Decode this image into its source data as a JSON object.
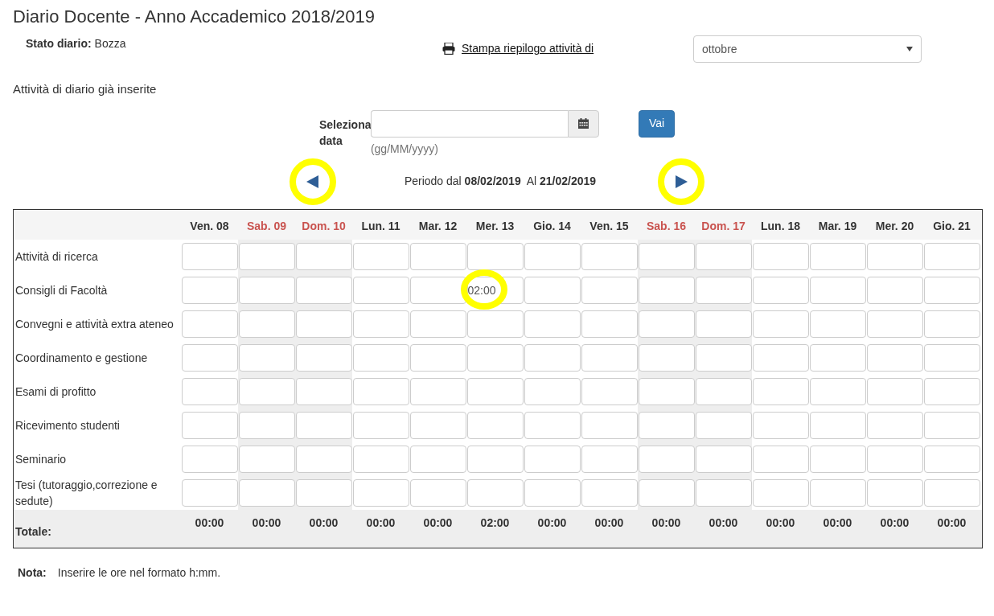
{
  "title": "Diario Docente - Anno Accademico 2018/2019",
  "status": {
    "label": "Stato diario:",
    "value": "Bozza"
  },
  "print_link": "Stampa riepilogo attività di",
  "month_select": {
    "value": "ottobre"
  },
  "section_title": "Attività di diario già inserite",
  "date_picker": {
    "label": "Seleziona data",
    "hint": "(gg/MM/yyyy)",
    "button": "Vai"
  },
  "period": {
    "prefix": "Periodo dal",
    "from": "08/02/2019",
    "middle": "Al",
    "to": "21/02/2019"
  },
  "prev_button": {
    "highlighted": true
  },
  "next_button": {
    "highlighted": true
  },
  "days": [
    {
      "label": "Ven. 08",
      "weekend": false
    },
    {
      "label": "Sab. 09",
      "weekend": true
    },
    {
      "label": "Dom. 10",
      "weekend": true
    },
    {
      "label": "Lun. 11",
      "weekend": false
    },
    {
      "label": "Mar. 12",
      "weekend": false
    },
    {
      "label": "Mer. 13",
      "weekend": false
    },
    {
      "label": "Gio. 14",
      "weekend": false
    },
    {
      "label": "Ven. 15",
      "weekend": false
    },
    {
      "label": "Sab. 16",
      "weekend": true
    },
    {
      "label": "Dom. 17",
      "weekend": true
    },
    {
      "label": "Lun. 18",
      "weekend": false
    },
    {
      "label": "Mar. 19",
      "weekend": false
    },
    {
      "label": "Mer. 20",
      "weekend": false
    },
    {
      "label": "Gio. 21",
      "weekend": false
    }
  ],
  "rows": [
    {
      "label": "Attività di ricerca",
      "cells": [
        {},
        {},
        {},
        {},
        {},
        {},
        {},
        {},
        {},
        {},
        {},
        {},
        {},
        {}
      ]
    },
    {
      "label": "Consigli di Facoltà",
      "cells": [
        {},
        {},
        {},
        {},
        {},
        {
          "value": "02:00",
          "highlighted": true
        },
        {},
        {},
        {},
        {},
        {},
        {},
        {},
        {}
      ]
    },
    {
      "label": "Convegni e attività extra ateneo",
      "cells": [
        {},
        {},
        {},
        {},
        {},
        {},
        {},
        {},
        {},
        {},
        {},
        {},
        {},
        {}
      ]
    },
    {
      "label": "Coordinamento e gestione",
      "cells": [
        {},
        {},
        {},
        {},
        {},
        {},
        {},
        {},
        {},
        {},
        {},
        {},
        {},
        {}
      ]
    },
    {
      "label": "Esami di profitto",
      "cells": [
        {},
        {},
        {},
        {},
        {},
        {},
        {},
        {},
        {},
        {},
        {},
        {},
        {},
        {}
      ]
    },
    {
      "label": "Ricevimento studenti",
      "cells": [
        {},
        {},
        {},
        {},
        {},
        {},
        {},
        {},
        {},
        {},
        {},
        {},
        {},
        {}
      ]
    },
    {
      "label": "Seminario",
      "cells": [
        {},
        {},
        {},
        {},
        {},
        {},
        {},
        {},
        {},
        {},
        {},
        {},
        {},
        {}
      ]
    },
    {
      "label": "Tesi (tutoraggio,correzione e sedute)",
      "cells": [
        {},
        {},
        {},
        {},
        {},
        {},
        {},
        {},
        {},
        {},
        {},
        {},
        {},
        {}
      ]
    }
  ],
  "totals": {
    "label": "Totale:",
    "values": [
      "00:00",
      "00:00",
      "00:00",
      "00:00",
      "00:00",
      "02:00",
      "00:00",
      "00:00",
      "00:00",
      "00:00",
      "00:00",
      "00:00",
      "00:00",
      "00:00"
    ]
  },
  "note": {
    "label": "Nota:",
    "text": "Inserire le ore nel formato h:mm."
  }
}
